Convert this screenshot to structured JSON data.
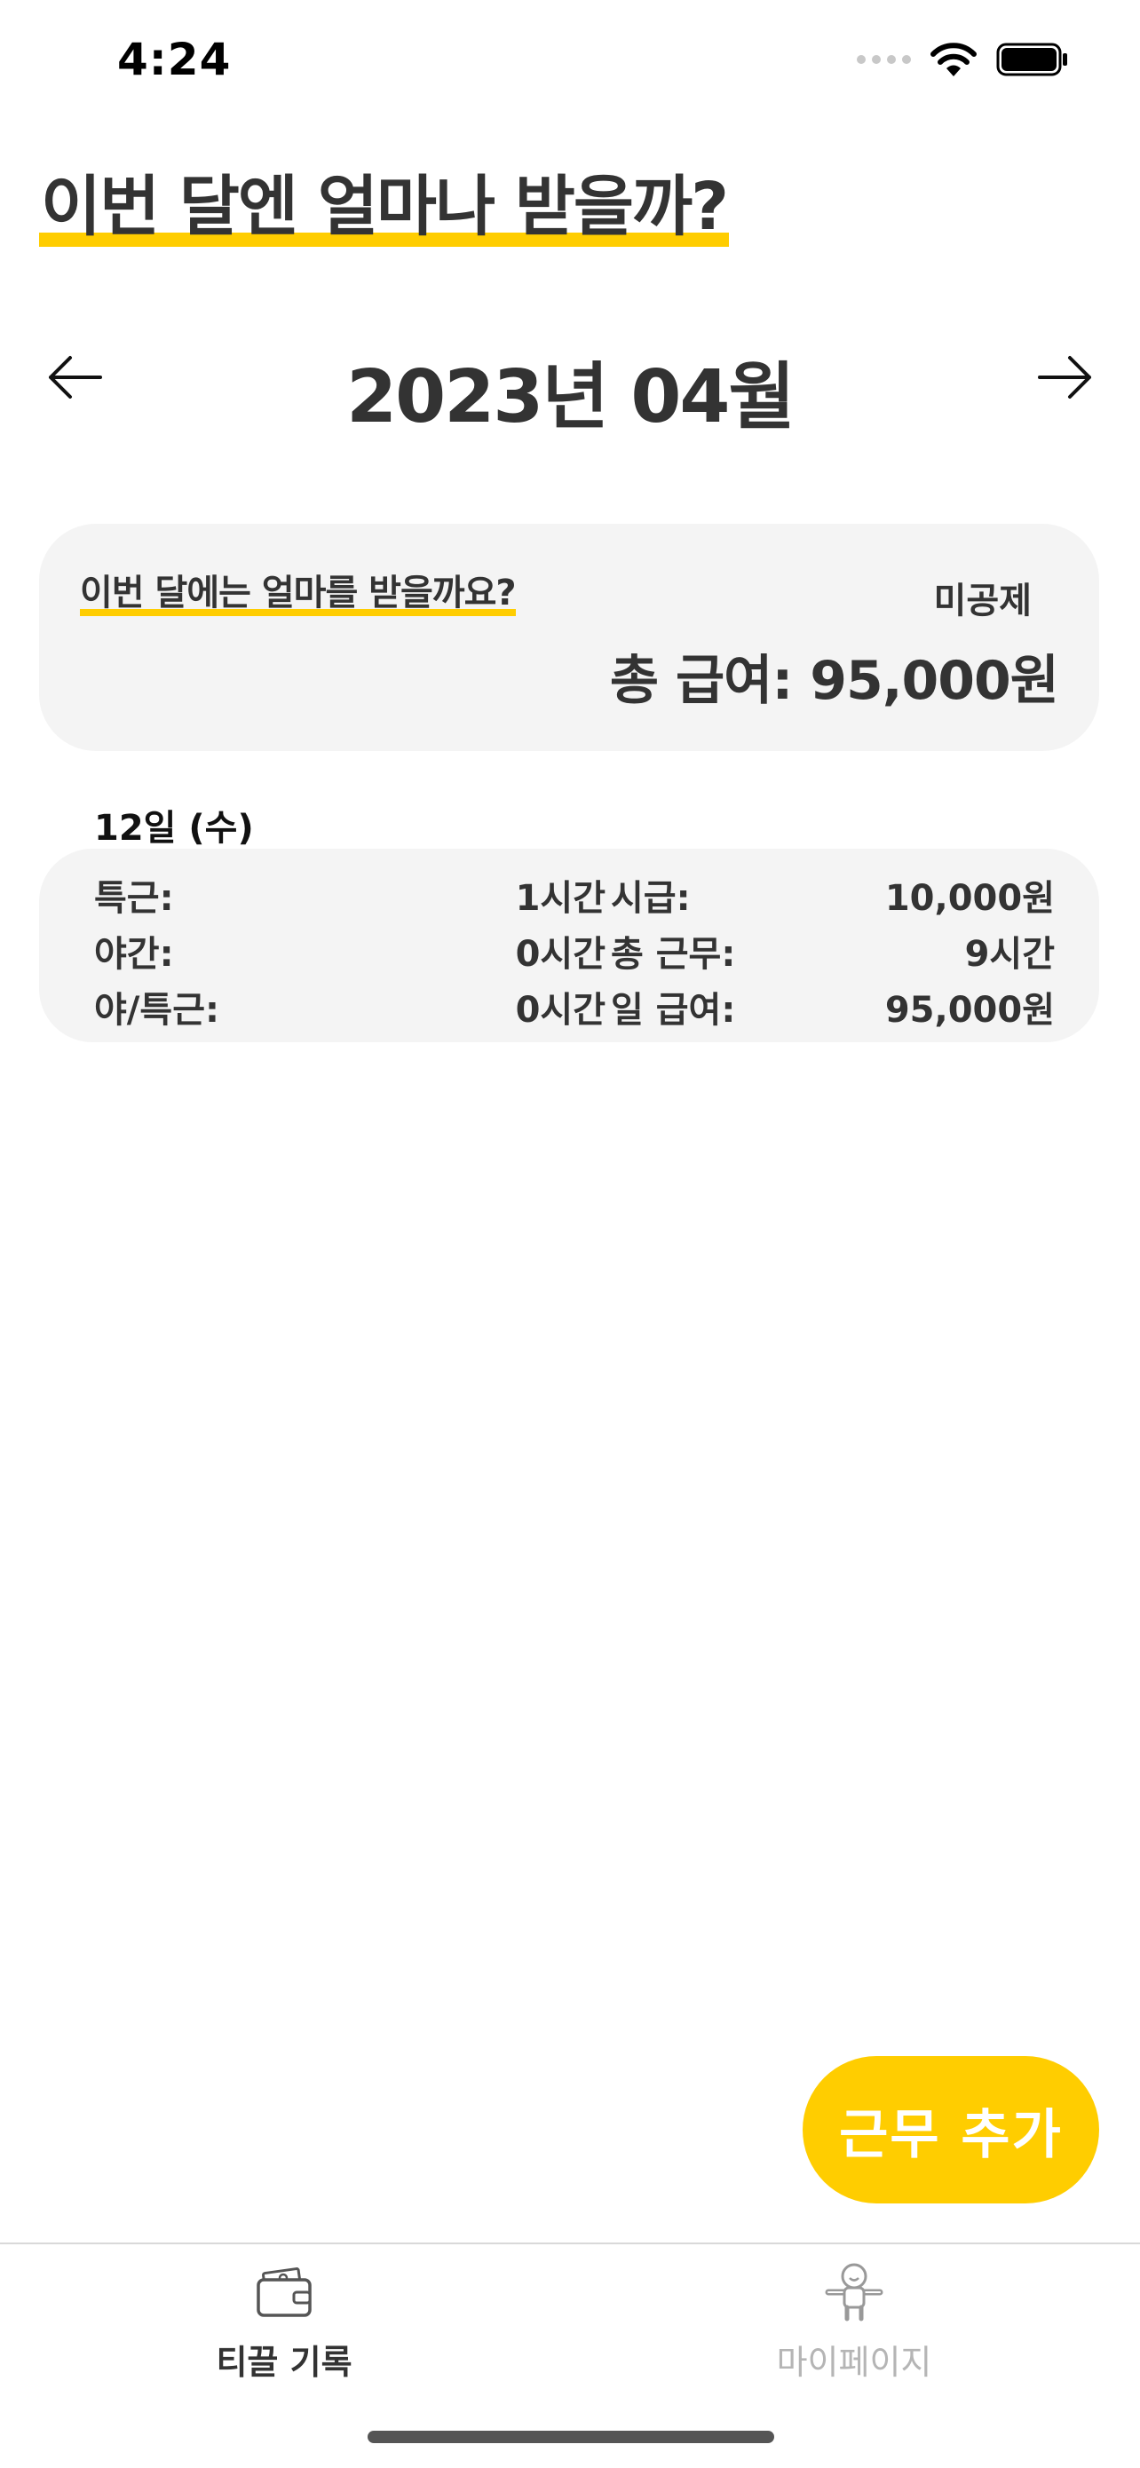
{
  "status_bar": {
    "time": "4:24"
  },
  "header": {
    "title": "이번 달엔 얼마나 받을까?"
  },
  "month_nav": {
    "label": "2023년 04월"
  },
  "summary": {
    "question": "이번 달에는 얼마를 받을까요?",
    "deduction_label": "미공제",
    "total_pay": "총 급여: 95,000원"
  },
  "day_entry": {
    "date": "12일 (수)",
    "left_rows": [
      {
        "label": "특근:",
        "value": "1시간"
      },
      {
        "label": "야간:",
        "value": "0시간"
      },
      {
        "label": "야/특근:",
        "value": "0시간"
      }
    ],
    "right_rows": [
      {
        "label": "시급:",
        "value": "10,000원"
      },
      {
        "label": "총 근무:",
        "value": "9시간"
      },
      {
        "label": "일 급여:",
        "value": "95,000원"
      }
    ]
  },
  "actions": {
    "add_work_label": "근무 추가"
  },
  "tabs": [
    {
      "label": "티끌 기록",
      "icon": "wallet-icon",
      "active": true
    },
    {
      "label": "마이페이지",
      "icon": "character-icon",
      "active": false
    }
  ],
  "colors": {
    "accent": "#FFCD00",
    "card_bg": "#F4F4F4",
    "text": "#333333",
    "inactive": "#B5B5B5"
  }
}
